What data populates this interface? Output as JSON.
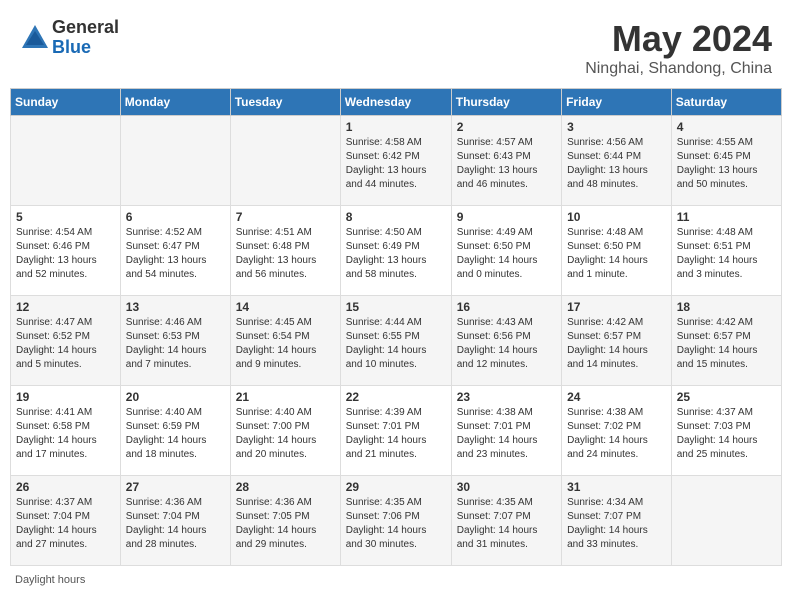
{
  "header": {
    "logo_general": "General",
    "logo_blue": "Blue",
    "month_title": "May 2024",
    "location": "Ninghai, Shandong, China"
  },
  "days_of_week": [
    "Sunday",
    "Monday",
    "Tuesday",
    "Wednesday",
    "Thursday",
    "Friday",
    "Saturday"
  ],
  "footer": {
    "daylight_label": "Daylight hours"
  },
  "weeks": [
    {
      "days": [
        {
          "num": "",
          "info": ""
        },
        {
          "num": "",
          "info": ""
        },
        {
          "num": "",
          "info": ""
        },
        {
          "num": "1",
          "info": "Sunrise: 4:58 AM\nSunset: 6:42 PM\nDaylight: 13 hours\nand 44 minutes."
        },
        {
          "num": "2",
          "info": "Sunrise: 4:57 AM\nSunset: 6:43 PM\nDaylight: 13 hours\nand 46 minutes."
        },
        {
          "num": "3",
          "info": "Sunrise: 4:56 AM\nSunset: 6:44 PM\nDaylight: 13 hours\nand 48 minutes."
        },
        {
          "num": "4",
          "info": "Sunrise: 4:55 AM\nSunset: 6:45 PM\nDaylight: 13 hours\nand 50 minutes."
        }
      ]
    },
    {
      "days": [
        {
          "num": "5",
          "info": "Sunrise: 4:54 AM\nSunset: 6:46 PM\nDaylight: 13 hours\nand 52 minutes."
        },
        {
          "num": "6",
          "info": "Sunrise: 4:52 AM\nSunset: 6:47 PM\nDaylight: 13 hours\nand 54 minutes."
        },
        {
          "num": "7",
          "info": "Sunrise: 4:51 AM\nSunset: 6:48 PM\nDaylight: 13 hours\nand 56 minutes."
        },
        {
          "num": "8",
          "info": "Sunrise: 4:50 AM\nSunset: 6:49 PM\nDaylight: 13 hours\nand 58 minutes."
        },
        {
          "num": "9",
          "info": "Sunrise: 4:49 AM\nSunset: 6:50 PM\nDaylight: 14 hours\nand 0 minutes."
        },
        {
          "num": "10",
          "info": "Sunrise: 4:48 AM\nSunset: 6:50 PM\nDaylight: 14 hours\nand 1 minute."
        },
        {
          "num": "11",
          "info": "Sunrise: 4:48 AM\nSunset: 6:51 PM\nDaylight: 14 hours\nand 3 minutes."
        }
      ]
    },
    {
      "days": [
        {
          "num": "12",
          "info": "Sunrise: 4:47 AM\nSunset: 6:52 PM\nDaylight: 14 hours\nand 5 minutes."
        },
        {
          "num": "13",
          "info": "Sunrise: 4:46 AM\nSunset: 6:53 PM\nDaylight: 14 hours\nand 7 minutes."
        },
        {
          "num": "14",
          "info": "Sunrise: 4:45 AM\nSunset: 6:54 PM\nDaylight: 14 hours\nand 9 minutes."
        },
        {
          "num": "15",
          "info": "Sunrise: 4:44 AM\nSunset: 6:55 PM\nDaylight: 14 hours\nand 10 minutes."
        },
        {
          "num": "16",
          "info": "Sunrise: 4:43 AM\nSunset: 6:56 PM\nDaylight: 14 hours\nand 12 minutes."
        },
        {
          "num": "17",
          "info": "Sunrise: 4:42 AM\nSunset: 6:57 PM\nDaylight: 14 hours\nand 14 minutes."
        },
        {
          "num": "18",
          "info": "Sunrise: 4:42 AM\nSunset: 6:57 PM\nDaylight: 14 hours\nand 15 minutes."
        }
      ]
    },
    {
      "days": [
        {
          "num": "19",
          "info": "Sunrise: 4:41 AM\nSunset: 6:58 PM\nDaylight: 14 hours\nand 17 minutes."
        },
        {
          "num": "20",
          "info": "Sunrise: 4:40 AM\nSunset: 6:59 PM\nDaylight: 14 hours\nand 18 minutes."
        },
        {
          "num": "21",
          "info": "Sunrise: 4:40 AM\nSunset: 7:00 PM\nDaylight: 14 hours\nand 20 minutes."
        },
        {
          "num": "22",
          "info": "Sunrise: 4:39 AM\nSunset: 7:01 PM\nDaylight: 14 hours\nand 21 minutes."
        },
        {
          "num": "23",
          "info": "Sunrise: 4:38 AM\nSunset: 7:01 PM\nDaylight: 14 hours\nand 23 minutes."
        },
        {
          "num": "24",
          "info": "Sunrise: 4:38 AM\nSunset: 7:02 PM\nDaylight: 14 hours\nand 24 minutes."
        },
        {
          "num": "25",
          "info": "Sunrise: 4:37 AM\nSunset: 7:03 PM\nDaylight: 14 hours\nand 25 minutes."
        }
      ]
    },
    {
      "days": [
        {
          "num": "26",
          "info": "Sunrise: 4:37 AM\nSunset: 7:04 PM\nDaylight: 14 hours\nand 27 minutes."
        },
        {
          "num": "27",
          "info": "Sunrise: 4:36 AM\nSunset: 7:04 PM\nDaylight: 14 hours\nand 28 minutes."
        },
        {
          "num": "28",
          "info": "Sunrise: 4:36 AM\nSunset: 7:05 PM\nDaylight: 14 hours\nand 29 minutes."
        },
        {
          "num": "29",
          "info": "Sunrise: 4:35 AM\nSunset: 7:06 PM\nDaylight: 14 hours\nand 30 minutes."
        },
        {
          "num": "30",
          "info": "Sunrise: 4:35 AM\nSunset: 7:07 PM\nDaylight: 14 hours\nand 31 minutes."
        },
        {
          "num": "31",
          "info": "Sunrise: 4:34 AM\nSunset: 7:07 PM\nDaylight: 14 hours\nand 33 minutes."
        },
        {
          "num": "",
          "info": ""
        }
      ]
    }
  ]
}
